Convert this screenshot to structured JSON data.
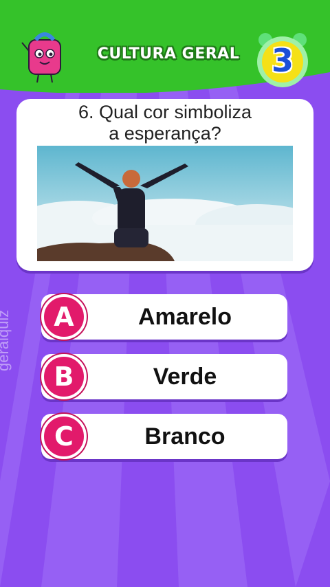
{
  "header": {
    "title": "CULTURA GERAL",
    "timer": "3",
    "colors": {
      "green": "#35c22a",
      "purple": "#8b4df0"
    }
  },
  "question": {
    "text_line1": "6. Qual cor simboliza",
    "text_line2": "a esperança?",
    "image": "person-arms-raised-above-clouds"
  },
  "options": [
    {
      "letter": "A",
      "label": "Amarelo"
    },
    {
      "letter": "B",
      "label": "Verde"
    },
    {
      "letter": "C",
      "label": "Branco"
    }
  ],
  "watermark": "geralquiz",
  "icons": [
    "mascot-backpack-icon",
    "alarm-clock-icon"
  ]
}
